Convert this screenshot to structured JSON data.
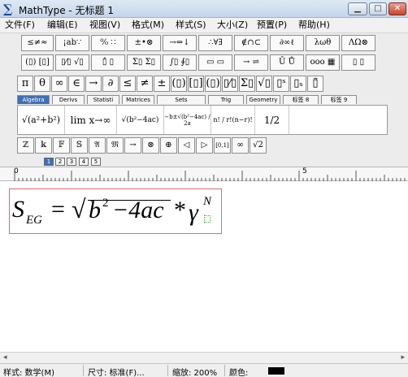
{
  "window": {
    "title": "MathType - 无标题 1",
    "app_icon": "∑",
    "minimize": "▁",
    "maximize": "□",
    "close": "✕"
  },
  "menu": [
    "文件(F)",
    "编辑(E)",
    "视图(V)",
    "格式(M)",
    "样式(S)",
    "大小(Z)",
    "预置(P)",
    "帮助(H)"
  ],
  "palette_row1": [
    "≤≠≈",
    "¡ab∵",
    "⁰⁄₀ ∷",
    "±•⊗",
    "→⇔↓",
    "∴∀∃",
    "∉∩⊂",
    "∂∞ℓ",
    "λωθ",
    "ΛΩ⊗"
  ],
  "palette_row2": [
    "(▯) [▯]",
    "▯⁄▯ √▯",
    "▯̂ ▯",
    "Σ▯ Σ▯",
    "∫▯ ∮▯",
    "▭ ▭",
    "→ ⇌",
    "Ū Ů",
    "ooo ▦",
    "▯ ▯"
  ],
  "symbol_row": [
    "π",
    "θ",
    "∞",
    "∈",
    "→",
    "∂",
    "≤",
    "≠",
    "±",
    "(▯)",
    "[▯]",
    "(▯)",
    "▯⁄▯",
    "Σ▯",
    "√▯",
    "▯ˢ",
    "▯ₛ",
    "▯̃"
  ],
  "tabs": [
    "Algebra",
    "Derivs",
    "Statisti",
    "Matrices",
    "Sets",
    "Trig",
    "Geometry",
    "标签 8",
    "标签 9"
  ],
  "templates": [
    "√(a²+b²)",
    "lim x→∞",
    "√(b²−4ac)",
    "−b±√(b²−4ac) / 2a",
    "n! / r!(n−r)!",
    "1/2"
  ],
  "small_row": [
    "ℤ",
    "𝕜",
    "𝔽",
    "𝕊",
    "𝔄",
    "𝔐",
    "→",
    "⊗",
    "⊕",
    "◁",
    "▷",
    "[0,1]",
    "∞",
    "√2"
  ],
  "size_tabs": [
    "1",
    "2",
    "3",
    "4",
    "5"
  ],
  "ruler": {
    "zero": "0",
    "mid": "5"
  },
  "formula": {
    "S": "S",
    "sub_EG": "EG",
    "equals": "=",
    "sqrt": "√",
    "b": "b",
    "exp2": "2",
    "rest": "−4ac",
    "star": "*",
    "gamma": "γ",
    "sup_N": "N"
  },
  "status": {
    "style": "样式: 数学(M)",
    "size": "尺寸: 标准(F)...",
    "zoom": "缩放: 200%",
    "color": "颜色:",
    "color_value": "#000000"
  }
}
